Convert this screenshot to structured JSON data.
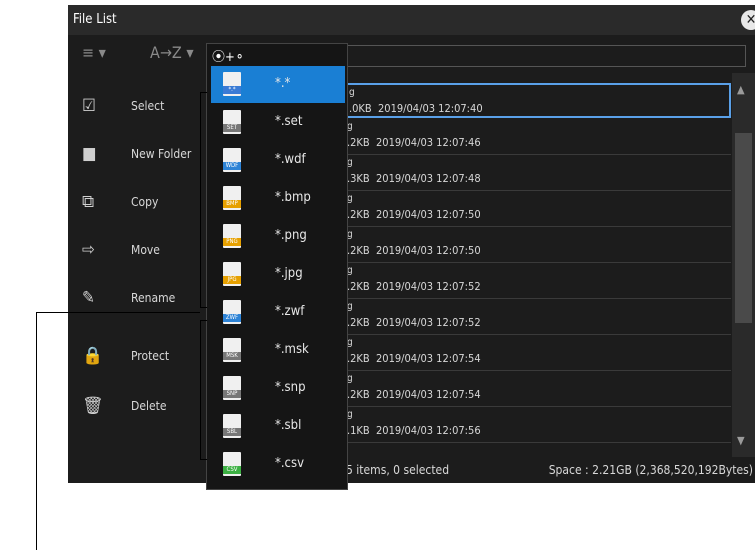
{
  "window": {
    "title": "File List",
    "close_icon": "close-icon"
  },
  "sidebar": {
    "items": [
      {
        "label": "Select",
        "icon": "checkbox-icon"
      },
      {
        "label": "New Folder",
        "icon": "new-folder-icon"
      },
      {
        "label": "Copy",
        "icon": "copy-icon"
      },
      {
        "label": "Move",
        "icon": "move-icon"
      },
      {
        "label": "Rename",
        "icon": "pencil-icon"
      },
      {
        "label": "Protect",
        "icon": "lock-icon"
      },
      {
        "label": "Delete",
        "icon": "trash-icon"
      }
    ]
  },
  "filter_menu": {
    "header_symbol": "⦿+⚬",
    "items": [
      {
        "ext": "*.*",
        "tag": "*.*",
        "tag_color": "#3a7bd5"
      },
      {
        "ext": "*.set",
        "tag": "SET",
        "tag_color": "#777777"
      },
      {
        "ext": "*.wdf",
        "tag": "WDF",
        "tag_color": "#2d83d6"
      },
      {
        "ext": "*.bmp",
        "tag": "BMP",
        "tag_color": "#e6a000"
      },
      {
        "ext": "*.png",
        "tag": "PNG",
        "tag_color": "#e6a000"
      },
      {
        "ext": "*.jpg",
        "tag": "JPG",
        "tag_color": "#e6a000"
      },
      {
        "ext": "*.zwf",
        "tag": "ZWF",
        "tag_color": "#2d83d6"
      },
      {
        "ext": "*.msk",
        "tag": "MSK",
        "tag_color": "#777777"
      },
      {
        "ext": "*.snp",
        "tag": "SNP",
        "tag_color": "#777777"
      },
      {
        "ext": "*.sbl",
        "tag": "SBL",
        "tag_color": "#777777"
      },
      {
        "ext": "*.csv",
        "tag": "CSV",
        "tag_color": "#3cb043"
      }
    ]
  },
  "files": [
    {
      "name": "g",
      "detail": ".0KB  2019/04/03 12:07:40"
    },
    {
      "name": "g",
      "detail": ".2KB  2019/04/03 12:07:46"
    },
    {
      "name": "g",
      "detail": ".3KB  2019/04/03 12:07:48"
    },
    {
      "name": "g",
      "detail": ".2KB  2019/04/03 12:07:50"
    },
    {
      "name": "g",
      "detail": ".2KB  2019/04/03 12:07:50"
    },
    {
      "name": "g",
      "detail": ".2KB  2019/04/03 12:07:52"
    },
    {
      "name": "g",
      "detail": ".2KB  2019/04/03 12:07:52"
    },
    {
      "name": "g",
      "detail": ".2KB  2019/04/03 12:07:54"
    },
    {
      "name": "g",
      "detail": ".2KB  2019/04/03 12:07:54"
    },
    {
      "name": "g",
      "detail": ".1KB  2019/04/03 12:07:56"
    }
  ],
  "status": {
    "left": "5 items, 0 selected",
    "right": "Space : 2.21GB (2,368,520,192Bytes)"
  },
  "toolbar": {
    "list_icon": "≡ ▾",
    "sort_icon": "A→Z ▾"
  }
}
